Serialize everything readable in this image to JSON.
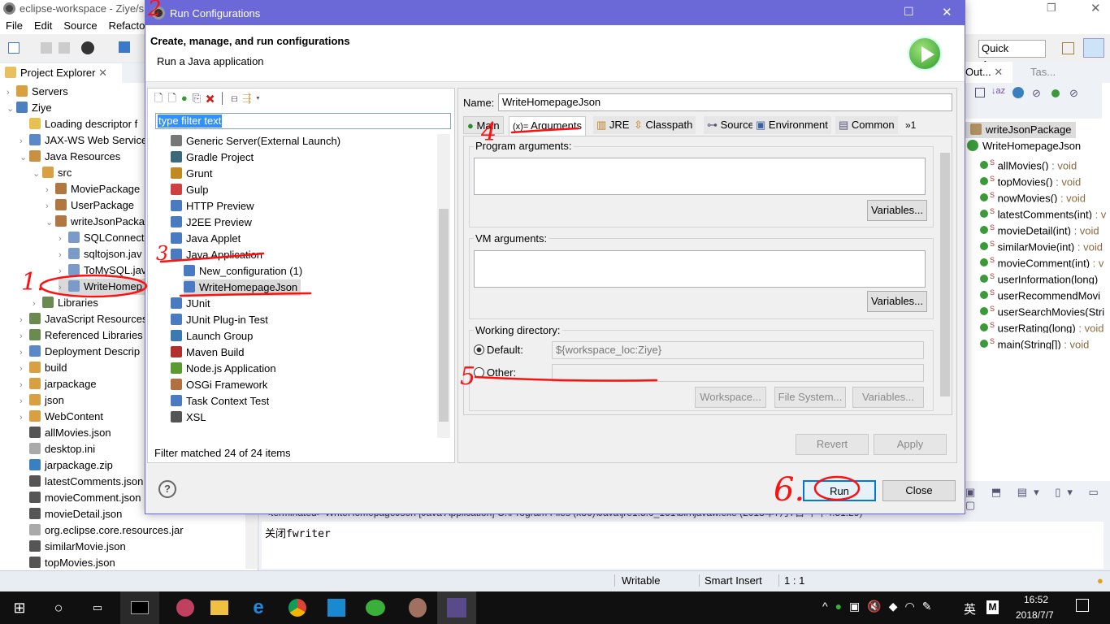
{
  "eclipse": {
    "title": "eclipse-workspace - Ziye/s",
    "menu": [
      "File",
      "Edit",
      "Source",
      "Refactor"
    ],
    "quick_access": "Quick Access",
    "project_explorer": {
      "title": "Project Explorer",
      "items": [
        {
          "label": "Servers",
          "level": 0,
          "chev": ">",
          "color": "#d8a040"
        },
        {
          "label": "Ziye",
          "level": 0,
          "chev": "v",
          "color": "#4a7fc0"
        },
        {
          "label": "Loading descriptor f",
          "level": 1,
          "chev": "",
          "color": "#e8c050"
        },
        {
          "label": "JAX-WS Web Service",
          "level": 1,
          "chev": ">",
          "color": "#5a88c8"
        },
        {
          "label": "Java Resources",
          "level": 1,
          "chev": "v",
          "color": "#c89040"
        },
        {
          "label": "src",
          "level": 2,
          "chev": "v",
          "color": "#d8a040"
        },
        {
          "label": "MoviePackage",
          "level": 3,
          "chev": ">",
          "color": "#b07840"
        },
        {
          "label": "UserPackage",
          "level": 3,
          "chev": ">",
          "color": "#b07840"
        },
        {
          "label": "writeJsonPacka",
          "level": 3,
          "chev": "v",
          "color": "#b07840"
        },
        {
          "label": "SQLConnect",
          "level": 4,
          "chev": ">",
          "color": "#7a9ac8"
        },
        {
          "label": "sqltojson.jav",
          "level": 4,
          "chev": ">",
          "color": "#7a9ac8"
        },
        {
          "label": "ToMySQL.jav",
          "level": 4,
          "chev": ">",
          "color": "#7a9ac8"
        },
        {
          "label": "WriteHomep",
          "level": 4,
          "chev": ">",
          "color": "#7a9ac8",
          "selected": true
        },
        {
          "label": "Libraries",
          "level": 2,
          "chev": ">",
          "color": "#6a8a50"
        },
        {
          "label": "JavaScript Resources",
          "level": 1,
          "chev": ">",
          "color": "#6a8a50"
        },
        {
          "label": "Referenced Libraries",
          "level": 1,
          "chev": ">",
          "color": "#6a8a50"
        },
        {
          "label": "Deployment Descrip",
          "level": 1,
          "chev": ">",
          "color": "#5a88c8"
        },
        {
          "label": "build",
          "level": 1,
          "chev": ">",
          "color": "#d8a040"
        },
        {
          "label": "jarpackage",
          "level": 1,
          "chev": ">",
          "color": "#d8a040"
        },
        {
          "label": "json",
          "level": 1,
          "chev": ">",
          "color": "#d8a040"
        },
        {
          "label": "WebContent",
          "level": 1,
          "chev": ">",
          "color": "#d8a040"
        },
        {
          "label": "allMovies.json",
          "level": 1,
          "chev": "",
          "color": "#555555"
        },
        {
          "label": "desktop.ini",
          "level": 1,
          "chev": "",
          "color": "#aaaaaa"
        },
        {
          "label": "jarpackage.zip",
          "level": 1,
          "chev": "",
          "color": "#3a80c0"
        },
        {
          "label": "latestComments.json",
          "level": 1,
          "chev": "",
          "color": "#555555"
        },
        {
          "label": "movieComment.json",
          "level": 1,
          "chev": "",
          "color": "#555555"
        },
        {
          "label": "movieDetail.json",
          "level": 1,
          "chev": "",
          "color": "#555555"
        },
        {
          "label": "org.eclipse.core.resources.jar",
          "level": 1,
          "chev": "",
          "color": "#aaaaaa"
        },
        {
          "label": "similarMovie.json",
          "level": 1,
          "chev": "",
          "color": "#555555"
        },
        {
          "label": "topMovies.json",
          "level": 1,
          "chev": "",
          "color": "#555555"
        }
      ]
    },
    "outline": {
      "tab": "Out...",
      "tab2": "Tas...",
      "package": "writeJsonPackage",
      "class": "WriteHomepageJson",
      "methods": [
        [
          "allMovies()",
          " : void"
        ],
        [
          "topMovies()",
          " : void"
        ],
        [
          "nowMovies()",
          " : void"
        ],
        [
          "latestComments(int)",
          " : v"
        ],
        [
          "movieDetail(int)",
          " : void"
        ],
        [
          "similarMovie(int)",
          " : void"
        ],
        [
          "movieComment(int)",
          " : v"
        ],
        [
          "userInformation(long)",
          ""
        ],
        [
          "userRecommendMovi",
          ""
        ],
        [
          "userSearchMovies(Stri",
          ""
        ],
        [
          "userRating(long)",
          " : void"
        ],
        [
          "main(String[])",
          " : void"
        ]
      ]
    },
    "console": {
      "header": "<terminated> WriteHomepageJson [Java Application] C:\\Program Files (x86)\\Java\\jre1.8.0_161\\bin\\javaw.exe (2018年7月7日 下午4:51:29)",
      "output": "关闭fwriter"
    },
    "status": {
      "writable": "Writable",
      "insert": "Smart Insert",
      "position": "1 : 1"
    }
  },
  "dialog": {
    "title": "Run Configurations",
    "heading": "Create, manage, and run configurations",
    "subheading": "Run a Java application",
    "filter_placeholder": "type filter text",
    "filter_status": "Filter matched 24 of 24 items",
    "config_types": [
      {
        "label": "Generic Server(External Launch)",
        "level": 0,
        "color": "#777777"
      },
      {
        "label": "Gradle Project",
        "level": 0,
        "color": "#3a6a7a"
      },
      {
        "label": "Grunt",
        "level": 0,
        "color": "#c08a20"
      },
      {
        "label": "Gulp",
        "level": 0,
        "color": "#d04040"
      },
      {
        "label": "HTTP Preview",
        "level": 0,
        "color": "#4a7ac0"
      },
      {
        "label": "J2EE Preview",
        "level": 0,
        "color": "#4a7ac0"
      },
      {
        "label": "Java Applet",
        "level": 0,
        "color": "#4a7ac0"
      },
      {
        "label": "Java Application",
        "level": 0,
        "color": "#4a7ac0"
      },
      {
        "label": "New_configuration (1)",
        "level": 1,
        "color": "#4a7ac0"
      },
      {
        "label": "WriteHomepageJson",
        "level": 1,
        "color": "#4a7ac0",
        "selected": true
      },
      {
        "label": "JUnit",
        "level": 0,
        "color": "#4a7ac0"
      },
      {
        "label": "JUnit Plug-in Test",
        "level": 0,
        "color": "#4a7ac0"
      },
      {
        "label": "Launch Group",
        "level": 0,
        "color": "#3a7ab0"
      },
      {
        "label": "Maven Build",
        "level": 0,
        "color": "#b03030"
      },
      {
        "label": "Node.js Application",
        "level": 0,
        "color": "#5a9a30"
      },
      {
        "label": "OSGi Framework",
        "level": 0,
        "color": "#b07040"
      },
      {
        "label": "Task Context Test",
        "level": 0,
        "color": "#4a7ac0"
      },
      {
        "label": "XSL",
        "level": 0,
        "color": "#555555"
      }
    ],
    "name_label": "Name:",
    "name_value": "WriteHomepageJson",
    "tabs": [
      "Main",
      "Arguments",
      "JRE",
      "Classpath",
      "Source",
      "Environment",
      "Common"
    ],
    "active_tab": "Arguments",
    "overflow": "»1",
    "program_args_label": "Program arguments:",
    "program_args": "",
    "vm_args_label": "VM arguments:",
    "vm_args": "",
    "variables": "Variables...",
    "working_dir_label": "Working directory:",
    "default_label": "Default:",
    "default_value": "${workspace_loc:Ziye}",
    "other_label": "Other:",
    "other_value": "",
    "workspace_btn": "Workspace...",
    "filesystem_btn": "File System...",
    "variables_btn": "Variables...",
    "revert": "Revert",
    "apply": "Apply",
    "run": "Run",
    "close": "Close"
  },
  "annotations": [
    "1.",
    "2",
    "3",
    "4",
    "5",
    "6."
  ],
  "taskbar": {
    "time": "16:52",
    "date": "2018/7/7",
    "ime": "英"
  },
  "colors": {
    "dialog_title": "#6b68d8",
    "selection": "#cce8ff",
    "annotation": "#ff1010"
  }
}
